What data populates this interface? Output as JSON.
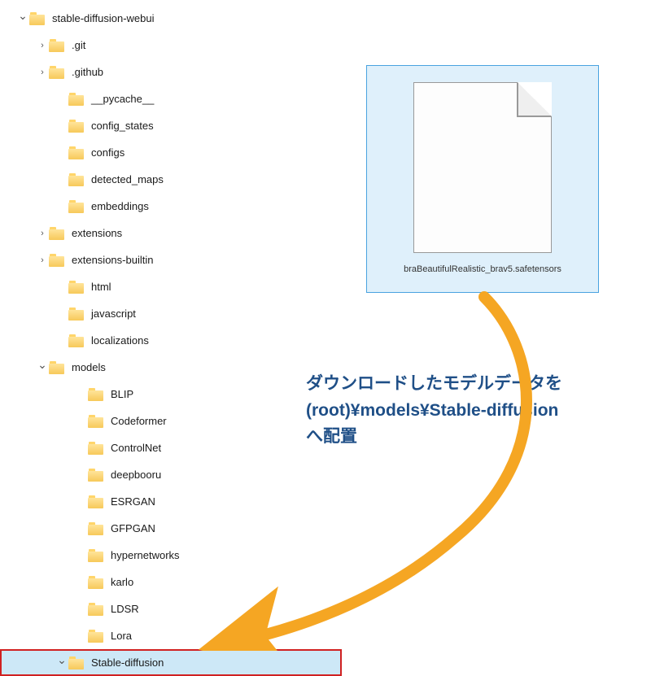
{
  "tree": [
    {
      "indent": 20,
      "chev": "v",
      "label": "stable-diffusion-webui"
    },
    {
      "indent": 44,
      "chev": ">",
      "label": ".git"
    },
    {
      "indent": 44,
      "chev": ">",
      "label": ".github"
    },
    {
      "indent": 68,
      "chev": "",
      "label": "__pycache__"
    },
    {
      "indent": 68,
      "chev": "",
      "label": "config_states"
    },
    {
      "indent": 68,
      "chev": "",
      "label": "configs"
    },
    {
      "indent": 68,
      "chev": "",
      "label": "detected_maps"
    },
    {
      "indent": 68,
      "chev": "",
      "label": "embeddings"
    },
    {
      "indent": 44,
      "chev": ">",
      "label": "extensions"
    },
    {
      "indent": 44,
      "chev": ">",
      "label": "extensions-builtin"
    },
    {
      "indent": 68,
      "chev": "",
      "label": "html"
    },
    {
      "indent": 68,
      "chev": "",
      "label": "javascript"
    },
    {
      "indent": 68,
      "chev": "",
      "label": "localizations"
    },
    {
      "indent": 44,
      "chev": "v",
      "label": "models"
    },
    {
      "indent": 92,
      "chev": "",
      "label": "BLIP"
    },
    {
      "indent": 92,
      "chev": "",
      "label": "Codeformer"
    },
    {
      "indent": 92,
      "chev": "",
      "label": "ControlNet"
    },
    {
      "indent": 92,
      "chev": "",
      "label": "deepbooru"
    },
    {
      "indent": 92,
      "chev": "",
      "label": "ESRGAN"
    },
    {
      "indent": 92,
      "chev": "",
      "label": "GFPGAN"
    },
    {
      "indent": 92,
      "chev": "",
      "label": "hypernetworks"
    },
    {
      "indent": 92,
      "chev": "",
      "label": "karlo"
    },
    {
      "indent": 92,
      "chev": "",
      "label": "LDSR"
    },
    {
      "indent": 92,
      "chev": "",
      "label": "Lora"
    },
    {
      "indent": 68,
      "chev": "v",
      "label": "Stable-diffusion",
      "selected": true,
      "highlight": true
    }
  ],
  "file_card": {
    "name": "braBeautifulRealistic_brav5.safetensors"
  },
  "annotation": {
    "line1": "ダウンロードしたモデルデータを",
    "line2": "(root)¥models¥Stable-diffusion",
    "line3": "へ配置"
  },
  "colors": {
    "arrow": "#f5a623",
    "anno_text": "#1f4f87",
    "selection": "#cde8f7",
    "highlight_border": "#d02121"
  }
}
